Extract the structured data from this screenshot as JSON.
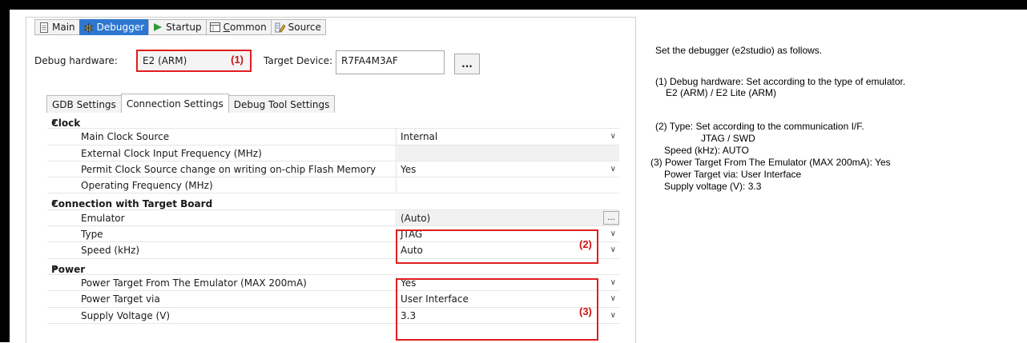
{
  "tabs": [
    {
      "label": "Main",
      "icon": "document-icon"
    },
    {
      "label": "Debugger",
      "icon": "bug-icon"
    },
    {
      "label": "Startup",
      "icon": "play-icon"
    },
    {
      "label_underlined": "C",
      "label_rest": "ommon",
      "icon": "window-icon"
    },
    {
      "label": "Source",
      "icon": "source-icon"
    }
  ],
  "debug_hardware": {
    "label": "Debug hardware:",
    "value": "E2 (ARM)",
    "marker": "(1)"
  },
  "target_device": {
    "label": "Target Device:",
    "value": "R7FA4M3AF",
    "browse": "..."
  },
  "subtabs": [
    "GDB Settings",
    "Connection Settings",
    "Debug Tool Settings"
  ],
  "grid": {
    "clock": {
      "title": "Clock",
      "main_clock_source": {
        "name": "Main Clock Source",
        "value": "Internal"
      },
      "external_clock": {
        "name": "External Clock Input Frequency (MHz)",
        "value": ""
      },
      "permit_clock": {
        "name": "Permit Clock Source change on writing on-chip Flash Memory",
        "value": "Yes"
      },
      "operating_freq": {
        "name": "Operating Frequency (MHz)",
        "value": ""
      }
    },
    "connection": {
      "title": "Connection with Target Board",
      "emulator": {
        "name": "Emulator",
        "value": "(Auto)",
        "browse": "..."
      },
      "type": {
        "name": "Type",
        "value": "JTAG"
      },
      "speed": {
        "name": "Speed (kHz)",
        "value": "Auto"
      },
      "marker": "(2)"
    },
    "power": {
      "title": "Power",
      "power_target": {
        "name": "Power Target From The Emulator (MAX 200mA)",
        "value": "Yes"
      },
      "power_via": {
        "name": "Power Target via",
        "value": "User Interface"
      },
      "supply": {
        "name": "Supply Voltage (V)",
        "value": "3.3"
      },
      "marker": "(3)"
    }
  },
  "notes": {
    "intro": "Set the debugger (e2studio) as follows.",
    "n1_a": "(1) Debug hardware: Set according to the type of emulator.",
    "n1_b": "E2 (ARM) / E2 Lite (ARM)",
    "n2_a": "(2) Type: Set according to the communication I/F.",
    "n2_b": "JTAG / SWD",
    "n2_c": "Speed (kHz): AUTO",
    "n3_a": "(3) Power Target From The Emulator (MAX 200mA): Yes",
    "n3_b": "Power Target via: User Interface",
    "n3_c": "Supply voltage (V): 3.3"
  },
  "colors": {
    "active_tab": "#2e77d0",
    "highlight": "#e01e1e"
  }
}
